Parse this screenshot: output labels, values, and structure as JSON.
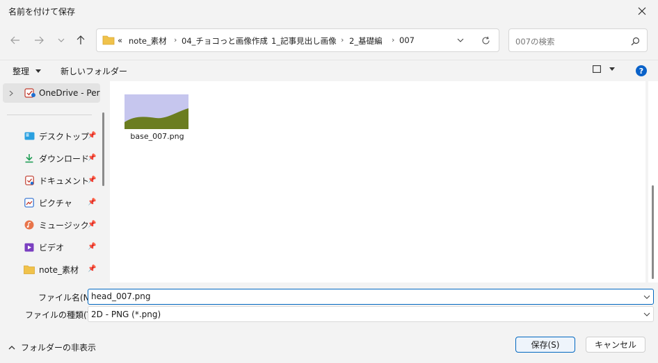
{
  "window": {
    "title": "名前を付けて保存"
  },
  "breadcrumb": {
    "overflow": "«",
    "items": [
      "note_素材",
      "04_チョコっと画像作成",
      "1_記事見出し画像",
      "2_基礎編",
      "007"
    ]
  },
  "search": {
    "placeholder": "007の検索"
  },
  "toolbar": {
    "organize_label": "整理",
    "new_folder_label": "新しいフォルダー"
  },
  "sidebar": {
    "onedrive_label": "OneDrive - Perso",
    "items": [
      {
        "label": "デスクトップ",
        "icon": "desktop-icon"
      },
      {
        "label": "ダウンロード",
        "icon": "download-icon"
      },
      {
        "label": "ドキュメント",
        "icon": "document-icon"
      },
      {
        "label": "ピクチャ",
        "icon": "pictures-icon"
      },
      {
        "label": "ミュージック",
        "icon": "music-icon"
      },
      {
        "label": "ビデオ",
        "icon": "video-icon"
      },
      {
        "label": "note_素材",
        "icon": "folder-icon"
      }
    ]
  },
  "files": [
    {
      "name": "base_007.png"
    }
  ],
  "form": {
    "filename_label": "ファイル名(N):",
    "filename_value": "head_007.png",
    "filetype_label": "ファイルの種類(T):",
    "filetype_value": "2D - PNG (*.png)"
  },
  "footer": {
    "hide_folders_label": "フォルダーの非表示",
    "save_label": "保存(S)",
    "cancel_label": "キャンセル"
  },
  "colors": {
    "accent": "#0067c0",
    "help": "#0a62c9"
  }
}
